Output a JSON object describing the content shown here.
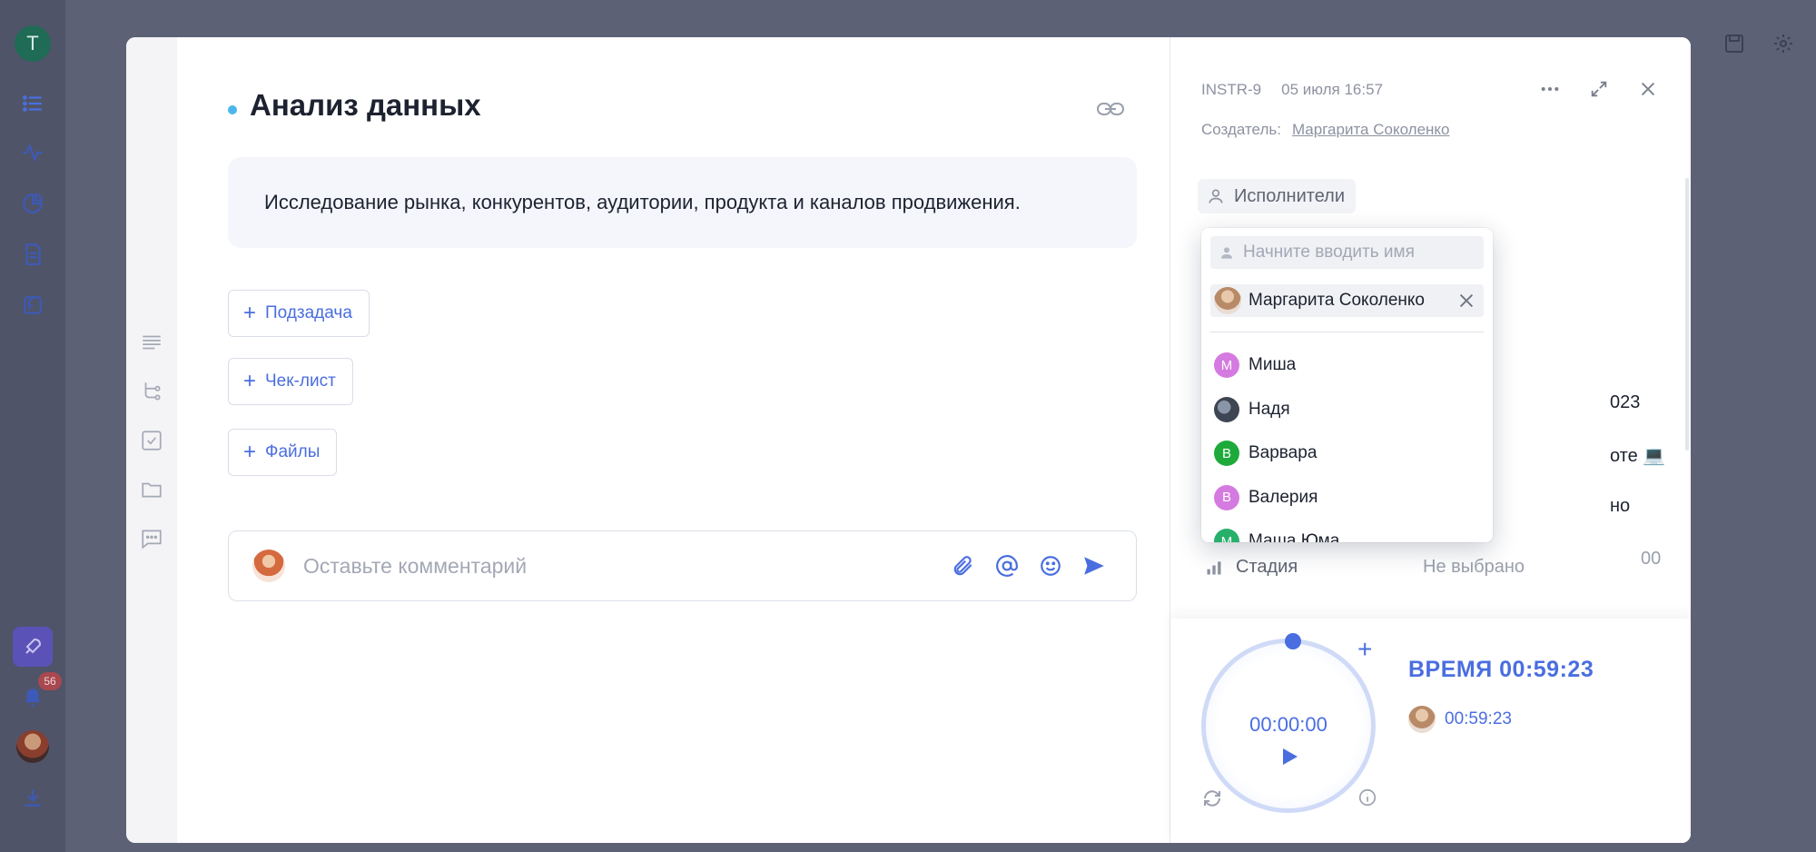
{
  "background": {
    "user_initial": "T",
    "notifications_count": "56"
  },
  "task": {
    "title": "Анализ данных",
    "description": "Исследование рынка, конкурентов, аудитории, продукта и каналов продвижения.",
    "add_subtask_label": "Подзадача",
    "add_checklist_label": "Чек-лист",
    "add_files_label": "Файлы",
    "comment_placeholder": "Оставьте комментарий"
  },
  "panel": {
    "task_id": "INSTR-9",
    "created_at": "05 июля 16:57",
    "creator_label": "Создатель:",
    "creator_name": "Маргарита Соколенко",
    "assignees_label": "Исполнители",
    "partial_date": "023",
    "partial_status": "оте 💻",
    "partial_value": "но",
    "partial_time": "00",
    "stage_label": "Стадия",
    "stage_value": "Не выбрано"
  },
  "timer": {
    "display": "00:00:00",
    "total_label": "ВРЕМЯ 00:59:23",
    "user_time": "00:59:23"
  },
  "dropdown": {
    "search_placeholder": "Начните вводить имя",
    "selected_name": "Маргарита Соколенко",
    "items": [
      {
        "name": "Миша",
        "initial": "М",
        "color": "#d57ae0"
      },
      {
        "name": "Надя",
        "initial": "",
        "color": "#4f5b6a"
      },
      {
        "name": "Варвара",
        "initial": "В",
        "color": "#1eaa3a"
      },
      {
        "name": "Валерия",
        "initial": "В",
        "color": "#d57ae0"
      },
      {
        "name": "Маша Юма",
        "initial": "М",
        "color": "#27b06b"
      }
    ]
  },
  "colors": {
    "accent": "#4a6ee0",
    "title_dot": "#4bb7ea",
    "overlay": "#5c6176"
  }
}
